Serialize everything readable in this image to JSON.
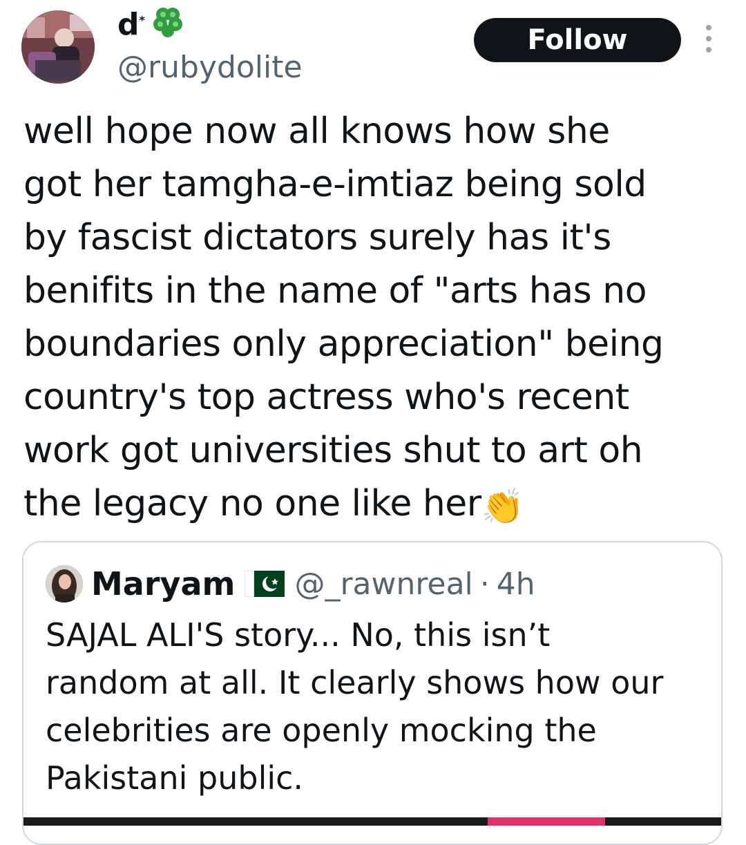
{
  "author": {
    "display_name_logo": "d",
    "display_name_logo_mark": "*",
    "handle": "@rubydolite",
    "avatar": "avatar"
  },
  "header": {
    "follow_label": "Follow",
    "more_icon": "more-vertical-icon",
    "clover_icon": "four-leaf-clover-icon"
  },
  "tweet": {
    "lines": [
      "well hope now all knows how she",
      "got her tamgha-e-imtiaz being sold",
      "by fascist dictators surely has it's",
      "benifits in the name of \"arts has no",
      "boundaries only appreciation\" being",
      "country's top actress who's recent",
      "work got universities shut to art oh",
      "the legacy no one like her"
    ],
    "emoji": "👏"
  },
  "quoted": {
    "name": "Maryam",
    "flag": "pakistan-flag-icon",
    "handle": "@_rawnreal",
    "separator": "·",
    "time": "4h",
    "lines": [
      "SAJAL ALI'S story... No, this isn’t",
      "random at all. It clearly shows how our",
      "celebrities are openly mocking the",
      "Pakistani public."
    ]
  },
  "colors": {
    "text": "#0f1419",
    "muted": "#536471",
    "border": "#cfd9de",
    "button_bg": "#0f1419",
    "button_text": "#ffffff",
    "clover": "#2e9e3e",
    "flag_green": "#01411c",
    "media_accent": "#e0336c"
  }
}
